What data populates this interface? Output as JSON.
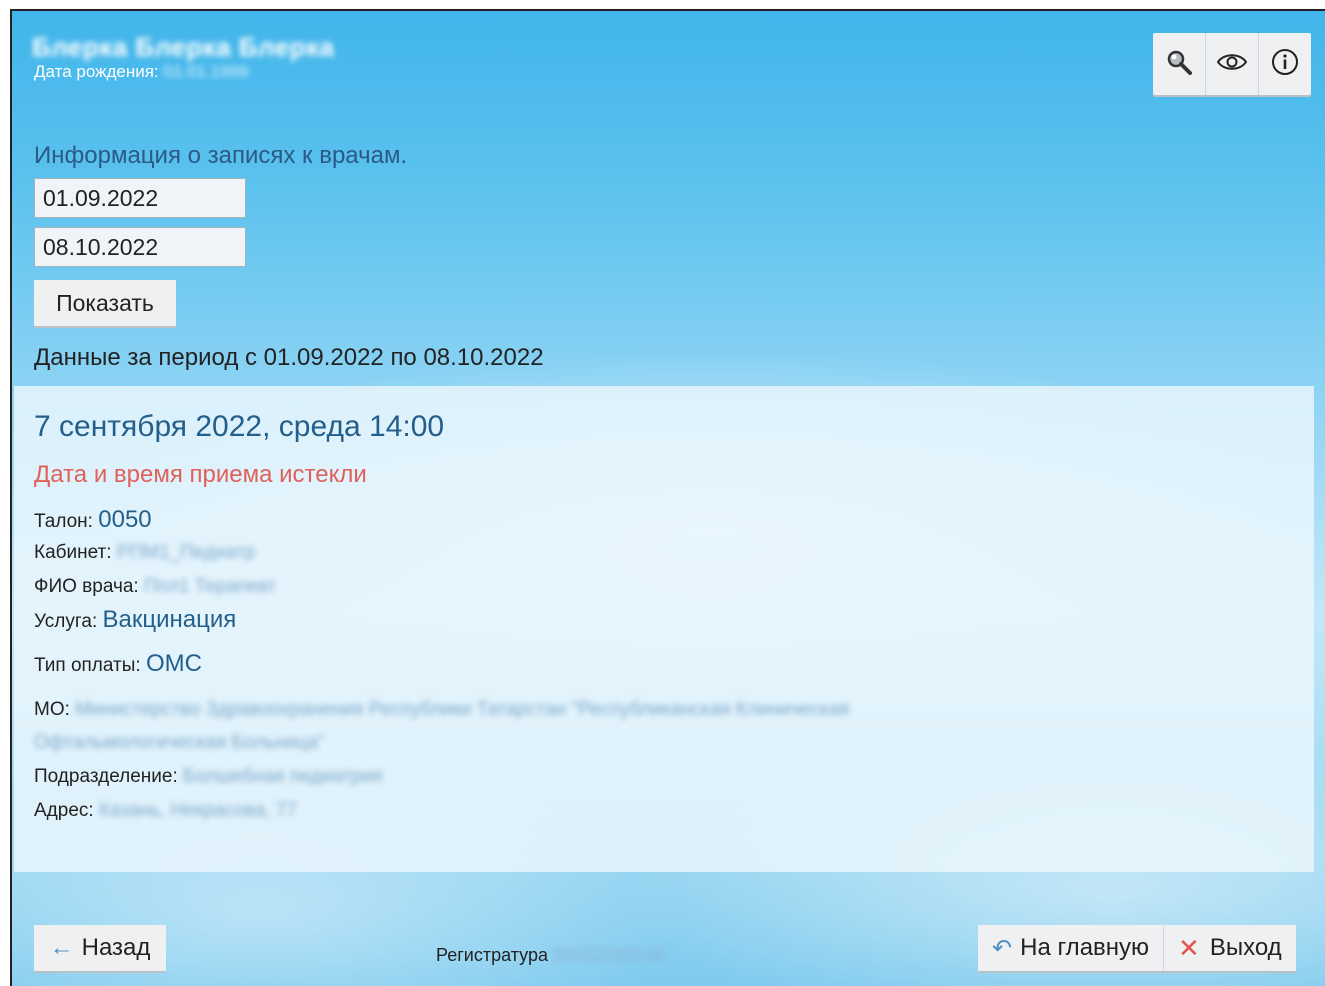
{
  "patient": {
    "name": "Блерка Блерка Блерка",
    "dob_label": "Дата рождения:",
    "dob_value": "01.01.1999"
  },
  "toolbar": {
    "icons": [
      "search-icon",
      "eye-icon",
      "info-icon"
    ]
  },
  "filter": {
    "title": "Информация о записях к врачам.",
    "date_from": "01.09.2022",
    "date_to": "08.10.2022",
    "show_label": "Показать",
    "period_text": "Данные за период с 01.09.2022 по 08.10.2022"
  },
  "appointment": {
    "datetime": "7 сентября 2022, среда 14:00",
    "status": "Дата и время приема истекли",
    "ticket_label": "Талон:",
    "ticket_value": "0050",
    "cabinet_label": "Кабинет:",
    "cabinet_value": "РПМ1_Педиатр",
    "doctor_label": "ФИО врача:",
    "doctor_value": "Ппл1 Терапевт",
    "service_label": "Услуга:",
    "service_value": "Вакцинация",
    "payment_label": "Тип оплаты:",
    "payment_value": "ОМС",
    "mo_label": "МО:",
    "mo_value_line1": "Министерство Здравоохранения Республики Татарстан \"Республиканская Клиническая",
    "mo_value_line2": "Офтальмологическая Больница\"",
    "division_label": "Подразделение:",
    "division_value": "Болшебная педиатрия",
    "address_label": "Адрес:",
    "address_value": "Казань, Некрасова, 77"
  },
  "footer": {
    "back_label": "Назад",
    "registry_label": "Регистратура",
    "registry_value": "88552290548",
    "home_label": "На главную",
    "exit_label": "Выход"
  },
  "colors": {
    "accent_text": "#245f8c",
    "expired_text": "#e0615a",
    "exit_icon": "#e4544c",
    "arrow_icon": "#4f8ec0"
  }
}
